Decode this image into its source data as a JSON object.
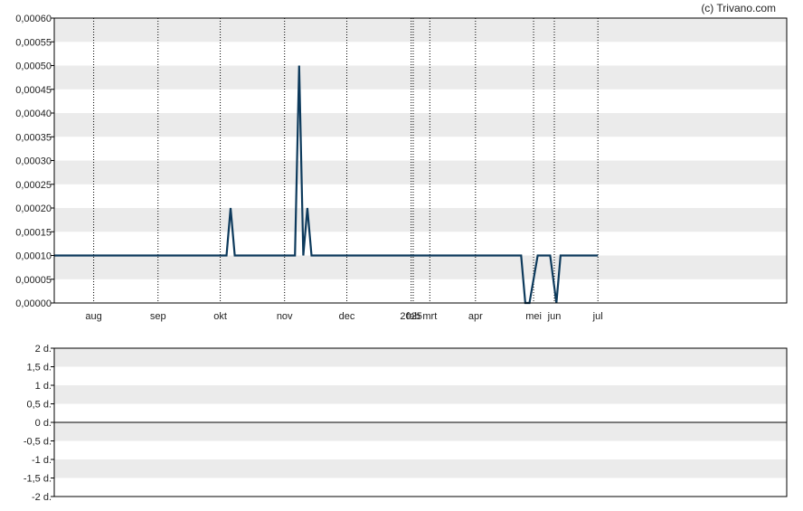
{
  "copyright": "(c) Trivano.com",
  "colors": {
    "line": "#0d3a5c",
    "band": "#ebebeb",
    "frame": "#000000",
    "grid": "#000000"
  },
  "chart_data": [
    {
      "type": "line",
      "title": "",
      "xlabel": "",
      "ylabel": "",
      "ylim": [
        0,
        0.0006
      ],
      "y_tick_labels": [
        "0,00000",
        "0,00005",
        "0,00010",
        "0,00015",
        "0,00020",
        "0,00025",
        "0,00030",
        "0,00035",
        "0,00040",
        "0,00045",
        "0,00050",
        "0,00055",
        "0,00060"
      ],
      "x_range": [
        "2024-07-13",
        "2025-07-01"
      ],
      "x_ticks": [
        {
          "label": "aug",
          "date": "2024-08-01"
        },
        {
          "label": "sep",
          "date": "2024-09-01"
        },
        {
          "label": "okt",
          "date": "2024-10-01"
        },
        {
          "label": "nov",
          "date": "2024-11-01"
        },
        {
          "label": "dec",
          "date": "2024-12-01"
        },
        {
          "label": "2025",
          "date": "2025-01-01"
        },
        {
          "label": "feb",
          "date": "2025-01-02"
        },
        {
          "label": "mrt",
          "date": "2025-01-10"
        },
        {
          "label": "apr",
          "date": "2025-02-01"
        },
        {
          "label": "mei",
          "date": "2025-03-01"
        },
        {
          "label": "jun",
          "date": "2025-03-11"
        },
        {
          "label": "jul",
          "date": "2025-04-01"
        }
      ],
      "grid_x": true,
      "series": [
        {
          "x": [
            "2024-07-13",
            "2024-10-04",
            "2024-10-06",
            "2024-10-08",
            "2024-11-05",
            "2024-11-06",
            "2024-11-08",
            "2024-11-10",
            "2024-11-12",
            "2024-11-14",
            "2024-11-16",
            "2025-02-23",
            "2025-02-25",
            "2025-02-27",
            "2025-03-03",
            "2025-03-07",
            "2025-03-09",
            "2025-03-12",
            "2025-03-14",
            "2025-04-01"
          ],
          "y": [
            0.0001,
            0.0001,
            0.0002,
            0.0001,
            0.0001,
            0.0001,
            0.0005,
            0.0001,
            0.0002,
            0.0001,
            0.0001,
            0.0001,
            0.0,
            0.0,
            0.0001,
            0.0001,
            0.0001,
            0.0,
            0.0001,
            0.0001
          ]
        }
      ]
    },
    {
      "type": "bar",
      "title": "",
      "xlabel": "",
      "ylabel": "",
      "ylim": [
        -2,
        2
      ],
      "y_tick_labels": [
        "-2 d.",
        "-1,5 d.",
        "-1 d.",
        "-0,5 d.",
        "0 d.",
        "0,5 d.",
        "1 d.",
        "1,5 d.",
        "2 d."
      ],
      "zero_line": true,
      "series": []
    }
  ]
}
